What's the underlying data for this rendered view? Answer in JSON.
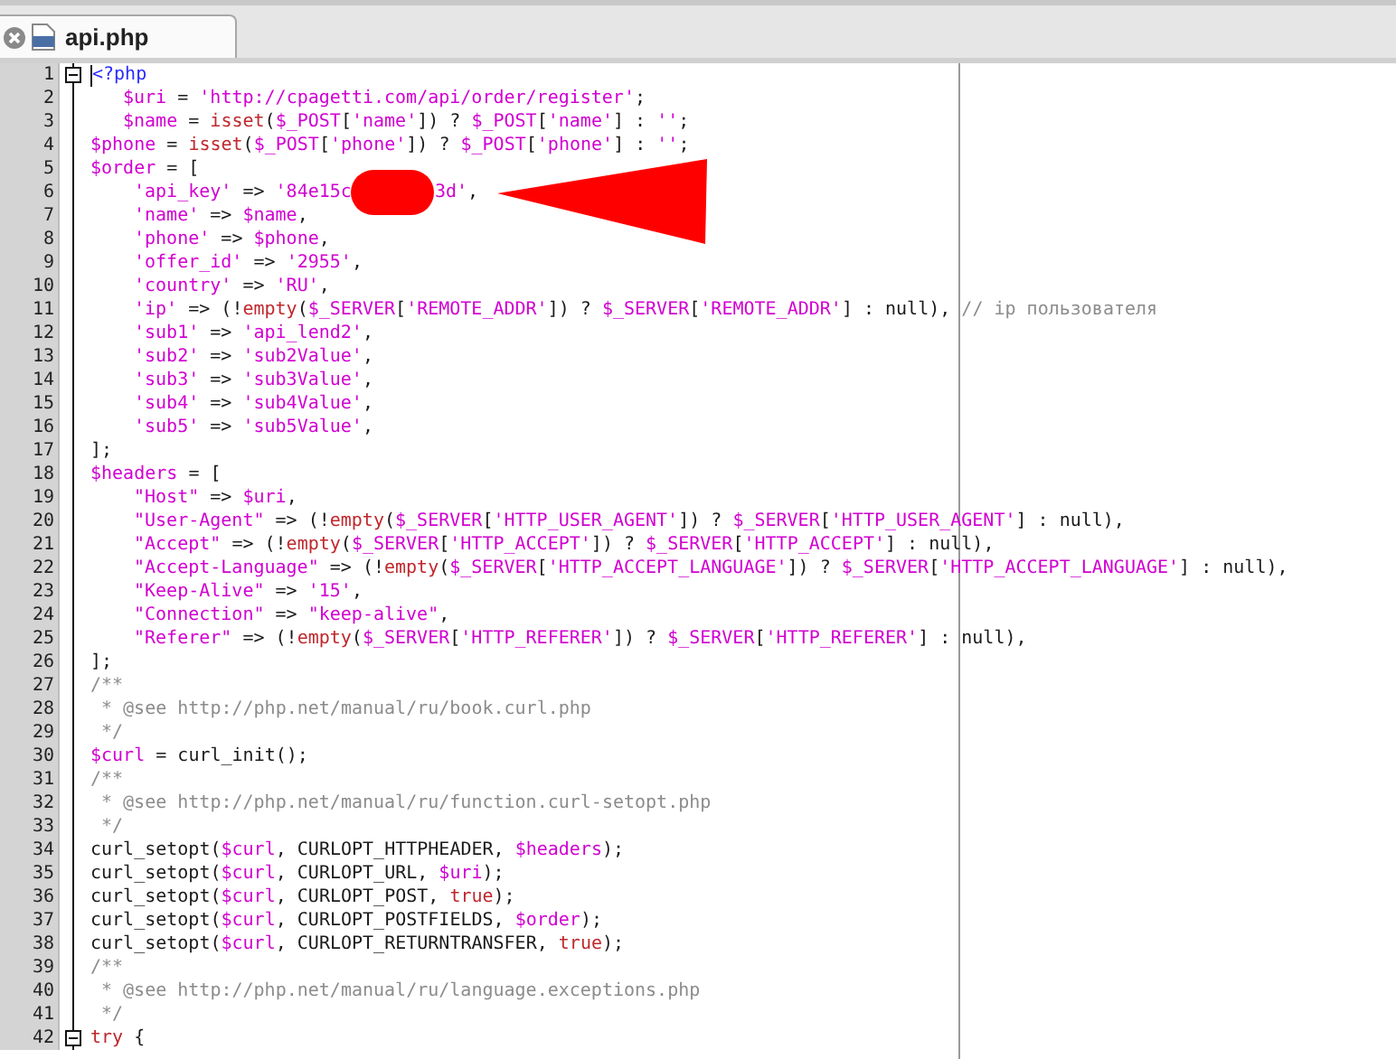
{
  "tab": {
    "title": "api.php",
    "selected": true
  },
  "lines": [
    {
      "number": "1",
      "fold": true,
      "cursor": true,
      "tokens": [
        {
          "kind": "tag",
          "text": "<?php"
        }
      ]
    },
    {
      "number": "2",
      "kind": "short",
      "tokens": [
        {
          "kind": "var",
          "text": "$uri"
        },
        {
          "kind": "plain",
          "text": " = "
        },
        {
          "kind": "str",
          "text": "'http://cpagetti.com/api/order/register'"
        },
        {
          "kind": "plain",
          "text": ";"
        }
      ]
    },
    {
      "number": "3",
      "kind": "short",
      "tokens": [
        {
          "kind": "var",
          "text": "$name"
        },
        {
          "kind": "plain",
          "text": " = "
        },
        {
          "kind": "kw",
          "text": "isset"
        },
        {
          "kind": "plain",
          "text": "("
        },
        {
          "kind": "var",
          "text": "$_POST"
        },
        {
          "kind": "plain",
          "text": "["
        },
        {
          "kind": "str",
          "text": "'name'"
        },
        {
          "kind": "plain",
          "text": "]) ? "
        },
        {
          "kind": "var",
          "text": "$_POST"
        },
        {
          "kind": "plain",
          "text": "["
        },
        {
          "kind": "str",
          "text": "'name'"
        },
        {
          "kind": "plain",
          "text": "] : "
        },
        {
          "kind": "str",
          "text": "''"
        },
        {
          "kind": "plain",
          "text": ";"
        }
      ]
    },
    {
      "number": "4",
      "tokens": [
        {
          "kind": "var",
          "text": "$phone"
        },
        {
          "kind": "plain",
          "text": " = "
        },
        {
          "kind": "kw",
          "text": "isset"
        },
        {
          "kind": "plain",
          "text": "("
        },
        {
          "kind": "var",
          "text": "$_POST"
        },
        {
          "kind": "plain",
          "text": "["
        },
        {
          "kind": "str",
          "text": "'phone'"
        },
        {
          "kind": "plain",
          "text": "]) ? "
        },
        {
          "kind": "var",
          "text": "$_POST"
        },
        {
          "kind": "plain",
          "text": "["
        },
        {
          "kind": "str",
          "text": "'phone'"
        },
        {
          "kind": "plain",
          "text": "] : "
        },
        {
          "kind": "str",
          "text": "''"
        },
        {
          "kind": "plain",
          "text": ";"
        }
      ]
    },
    {
      "number": "5",
      "tokens": [
        {
          "kind": "var",
          "text": "$order"
        },
        {
          "kind": "plain",
          "text": " = ["
        }
      ]
    },
    {
      "number": "6",
      "kind": "full",
      "tokens": [
        {
          "kind": "str",
          "text": "'api_key'"
        },
        {
          "kind": "plain",
          "text": " => "
        },
        {
          "kind": "str",
          "text": "'84e15c"
        },
        {
          "kind": "redacted"
        },
        {
          "kind": "str",
          "text": "3d'"
        },
        {
          "kind": "plain",
          "text": ","
        }
      ]
    },
    {
      "number": "7",
      "kind": "full",
      "tokens": [
        {
          "kind": "str",
          "text": "'name'"
        },
        {
          "kind": "plain",
          "text": " => "
        },
        {
          "kind": "var",
          "text": "$name"
        },
        {
          "kind": "plain",
          "text": ","
        }
      ]
    },
    {
      "number": "8",
      "kind": "full",
      "tokens": [
        {
          "kind": "str",
          "text": "'phone'"
        },
        {
          "kind": "plain",
          "text": " => "
        },
        {
          "kind": "var",
          "text": "$phone"
        },
        {
          "kind": "plain",
          "text": ","
        }
      ]
    },
    {
      "number": "9",
      "kind": "full",
      "tokens": [
        {
          "kind": "str",
          "text": "'offer_id'"
        },
        {
          "kind": "plain",
          "text": " => "
        },
        {
          "kind": "str",
          "text": "'2955'"
        },
        {
          "kind": "plain",
          "text": ","
        }
      ]
    },
    {
      "number": "10",
      "kind": "full",
      "tokens": [
        {
          "kind": "str",
          "text": "'country'"
        },
        {
          "kind": "plain",
          "text": " => "
        },
        {
          "kind": "str",
          "text": "'RU'"
        },
        {
          "kind": "plain",
          "text": ","
        }
      ]
    },
    {
      "number": "11",
      "kind": "full",
      "tokens": [
        {
          "kind": "str",
          "text": "'ip'"
        },
        {
          "kind": "plain",
          "text": " => (!"
        },
        {
          "kind": "kw",
          "text": "empty"
        },
        {
          "kind": "plain",
          "text": "("
        },
        {
          "kind": "var",
          "text": "$_SERVER"
        },
        {
          "kind": "plain",
          "text": "["
        },
        {
          "kind": "str",
          "text": "'REMOTE_ADDR'"
        },
        {
          "kind": "plain",
          "text": "]) ? "
        },
        {
          "kind": "var",
          "text": "$_SERVER"
        },
        {
          "kind": "plain",
          "text": "["
        },
        {
          "kind": "str",
          "text": "'REMOTE_ADDR'"
        },
        {
          "kind": "plain",
          "text": "] : null), "
        },
        {
          "kind": "comment",
          "text": "// ip пользователя"
        }
      ]
    },
    {
      "number": "12",
      "kind": "full",
      "tokens": [
        {
          "kind": "str",
          "text": "'sub1'"
        },
        {
          "kind": "plain",
          "text": " => "
        },
        {
          "kind": "str",
          "text": "'api_lend2'"
        },
        {
          "kind": "plain",
          "text": ","
        }
      ]
    },
    {
      "number": "13",
      "kind": "full",
      "tokens": [
        {
          "kind": "str",
          "text": "'sub2'"
        },
        {
          "kind": "plain",
          "text": " => "
        },
        {
          "kind": "str",
          "text": "'sub2Value'"
        },
        {
          "kind": "plain",
          "text": ","
        }
      ]
    },
    {
      "number": "14",
      "kind": "full",
      "tokens": [
        {
          "kind": "str",
          "text": "'sub3'"
        },
        {
          "kind": "plain",
          "text": " => "
        },
        {
          "kind": "str",
          "text": "'sub3Value'"
        },
        {
          "kind": "plain",
          "text": ","
        }
      ]
    },
    {
      "number": "15",
      "kind": "full",
      "tokens": [
        {
          "kind": "str",
          "text": "'sub4'"
        },
        {
          "kind": "plain",
          "text": " => "
        },
        {
          "kind": "str",
          "text": "'sub4Value'"
        },
        {
          "kind": "plain",
          "text": ","
        }
      ]
    },
    {
      "number": "16",
      "kind": "full",
      "tokens": [
        {
          "kind": "str",
          "text": "'sub5'"
        },
        {
          "kind": "plain",
          "text": " => "
        },
        {
          "kind": "str",
          "text": "'sub5Value'"
        },
        {
          "kind": "plain",
          "text": ","
        }
      ]
    },
    {
      "number": "17",
      "tokens": [
        {
          "kind": "plain",
          "text": "];"
        }
      ]
    },
    {
      "number": "18",
      "tokens": [
        {
          "kind": "var",
          "text": "$headers"
        },
        {
          "kind": "plain",
          "text": " = ["
        }
      ]
    },
    {
      "number": "19",
      "kind": "full",
      "tokens": [
        {
          "kind": "str",
          "text": "\"Host\""
        },
        {
          "kind": "plain",
          "text": " => "
        },
        {
          "kind": "var",
          "text": "$uri"
        },
        {
          "kind": "plain",
          "text": ","
        }
      ]
    },
    {
      "number": "20",
      "kind": "full",
      "tokens": [
        {
          "kind": "str",
          "text": "\"User-Agent\""
        },
        {
          "kind": "plain",
          "text": " => (!"
        },
        {
          "kind": "kw",
          "text": "empty"
        },
        {
          "kind": "plain",
          "text": "("
        },
        {
          "kind": "var",
          "text": "$_SERVER"
        },
        {
          "kind": "plain",
          "text": "["
        },
        {
          "kind": "str",
          "text": "'HTTP_USER_AGENT'"
        },
        {
          "kind": "plain",
          "text": "]) ? "
        },
        {
          "kind": "var",
          "text": "$_SERVER"
        },
        {
          "kind": "plain",
          "text": "["
        },
        {
          "kind": "str",
          "text": "'HTTP_USER_AGENT'"
        },
        {
          "kind": "plain",
          "text": "] : null),"
        }
      ]
    },
    {
      "number": "21",
      "kind": "full",
      "tokens": [
        {
          "kind": "str",
          "text": "\"Accept\""
        },
        {
          "kind": "plain",
          "text": " => (!"
        },
        {
          "kind": "kw",
          "text": "empty"
        },
        {
          "kind": "plain",
          "text": "("
        },
        {
          "kind": "var",
          "text": "$_SERVER"
        },
        {
          "kind": "plain",
          "text": "["
        },
        {
          "kind": "str",
          "text": "'HTTP_ACCEPT'"
        },
        {
          "kind": "plain",
          "text": "]) ? "
        },
        {
          "kind": "var",
          "text": "$_SERVER"
        },
        {
          "kind": "plain",
          "text": "["
        },
        {
          "kind": "str",
          "text": "'HTTP_ACCEPT'"
        },
        {
          "kind": "plain",
          "text": "] : null),"
        }
      ]
    },
    {
      "number": "22",
      "kind": "full",
      "tokens": [
        {
          "kind": "str",
          "text": "\"Accept-Language\""
        },
        {
          "kind": "plain",
          "text": " => (!"
        },
        {
          "kind": "kw",
          "text": "empty"
        },
        {
          "kind": "plain",
          "text": "("
        },
        {
          "kind": "var",
          "text": "$_SERVER"
        },
        {
          "kind": "plain",
          "text": "["
        },
        {
          "kind": "str",
          "text": "'HTTP_ACCEPT_LANGUAGE'"
        },
        {
          "kind": "plain",
          "text": "]) ? "
        },
        {
          "kind": "var",
          "text": "$_SERVER"
        },
        {
          "kind": "plain",
          "text": "["
        },
        {
          "kind": "str",
          "text": "'HTTP_ACCEPT_LANGUAGE'"
        },
        {
          "kind": "plain",
          "text": "] : null),"
        }
      ]
    },
    {
      "number": "23",
      "kind": "full",
      "tokens": [
        {
          "kind": "str",
          "text": "\"Keep-Alive\""
        },
        {
          "kind": "plain",
          "text": " => "
        },
        {
          "kind": "str",
          "text": "'15'"
        },
        {
          "kind": "plain",
          "text": ","
        }
      ]
    },
    {
      "number": "24",
      "kind": "full",
      "tokens": [
        {
          "kind": "str",
          "text": "\"Connection\""
        },
        {
          "kind": "plain",
          "text": " => "
        },
        {
          "kind": "str",
          "text": "\"keep-alive\""
        },
        {
          "kind": "plain",
          "text": ","
        }
      ]
    },
    {
      "number": "25",
      "kind": "full",
      "tokens": [
        {
          "kind": "str",
          "text": "\"Referer\""
        },
        {
          "kind": "plain",
          "text": " => (!"
        },
        {
          "kind": "kw",
          "text": "empty"
        },
        {
          "kind": "plain",
          "text": "("
        },
        {
          "kind": "var",
          "text": "$_SERVER"
        },
        {
          "kind": "plain",
          "text": "["
        },
        {
          "kind": "str",
          "text": "'HTTP_REFERER'"
        },
        {
          "kind": "plain",
          "text": "]) ? "
        },
        {
          "kind": "var",
          "text": "$_SERVER"
        },
        {
          "kind": "plain",
          "text": "["
        },
        {
          "kind": "str",
          "text": "'HTTP_REFERER'"
        },
        {
          "kind": "plain",
          "text": "] : null),"
        }
      ]
    },
    {
      "number": "26",
      "tokens": [
        {
          "kind": "plain",
          "text": "];"
        }
      ]
    },
    {
      "number": "27",
      "tokens": [
        {
          "kind": "comment",
          "text": "/**"
        }
      ]
    },
    {
      "number": "28",
      "kind": "single",
      "tokens": [
        {
          "kind": "comment",
          "text": "* @see http://php.net/manual/ru/book.curl.php"
        }
      ]
    },
    {
      "number": "29",
      "kind": "single",
      "tokens": [
        {
          "kind": "comment",
          "text": "*/"
        }
      ]
    },
    {
      "number": "30",
      "tokens": [
        {
          "kind": "var",
          "text": "$curl"
        },
        {
          "kind": "plain",
          "text": " = curl_init();"
        }
      ]
    },
    {
      "number": "31",
      "tokens": [
        {
          "kind": "comment",
          "text": "/**"
        }
      ]
    },
    {
      "number": "32",
      "kind": "single",
      "tokens": [
        {
          "kind": "comment",
          "text": "* @see http://php.net/manual/ru/function.curl-setopt.php"
        }
      ]
    },
    {
      "number": "33",
      "kind": "single",
      "tokens": [
        {
          "kind": "comment",
          "text": "*/"
        }
      ]
    },
    {
      "number": "34",
      "tokens": [
        {
          "kind": "plain",
          "text": "curl_setopt("
        },
        {
          "kind": "var",
          "text": "$curl"
        },
        {
          "kind": "plain",
          "text": ", CURLOPT_HTTPHEADER, "
        },
        {
          "kind": "var",
          "text": "$headers"
        },
        {
          "kind": "plain",
          "text": ");"
        }
      ]
    },
    {
      "number": "35",
      "tokens": [
        {
          "kind": "plain",
          "text": "curl_setopt("
        },
        {
          "kind": "var",
          "text": "$curl"
        },
        {
          "kind": "plain",
          "text": ", CURLOPT_URL, "
        },
        {
          "kind": "var",
          "text": "$uri"
        },
        {
          "kind": "plain",
          "text": ");"
        }
      ]
    },
    {
      "number": "36",
      "tokens": [
        {
          "kind": "plain",
          "text": "curl_setopt("
        },
        {
          "kind": "var",
          "text": "$curl"
        },
        {
          "kind": "plain",
          "text": ", CURLOPT_POST, "
        },
        {
          "kind": "kw",
          "text": "true"
        },
        {
          "kind": "plain",
          "text": ");"
        }
      ]
    },
    {
      "number": "37",
      "tokens": [
        {
          "kind": "plain",
          "text": "curl_setopt("
        },
        {
          "kind": "var",
          "text": "$curl"
        },
        {
          "kind": "plain",
          "text": ", CURLOPT_POSTFIELDS, "
        },
        {
          "kind": "var",
          "text": "$order"
        },
        {
          "kind": "plain",
          "text": ");"
        }
      ]
    },
    {
      "number": "38",
      "tokens": [
        {
          "kind": "plain",
          "text": "curl_setopt("
        },
        {
          "kind": "var",
          "text": "$curl"
        },
        {
          "kind": "plain",
          "text": ", CURLOPT_RETURNTRANSFER, "
        },
        {
          "kind": "kw",
          "text": "true"
        },
        {
          "kind": "plain",
          "text": ");"
        }
      ]
    },
    {
      "number": "39",
      "tokens": [
        {
          "kind": "comment",
          "text": "/**"
        }
      ]
    },
    {
      "number": "40",
      "kind": "single",
      "tokens": [
        {
          "kind": "comment",
          "text": "* @see http://php.net/manual/ru/language.exceptions.php"
        }
      ]
    },
    {
      "number": "41",
      "kind": "single",
      "tokens": [
        {
          "kind": "comment",
          "text": "*/"
        }
      ]
    },
    {
      "number": "42",
      "fold": true,
      "tokens": [
        {
          "kind": "kw",
          "text": "try"
        },
        {
          "kind": "plain",
          "text": " {"
        }
      ]
    }
  ]
}
